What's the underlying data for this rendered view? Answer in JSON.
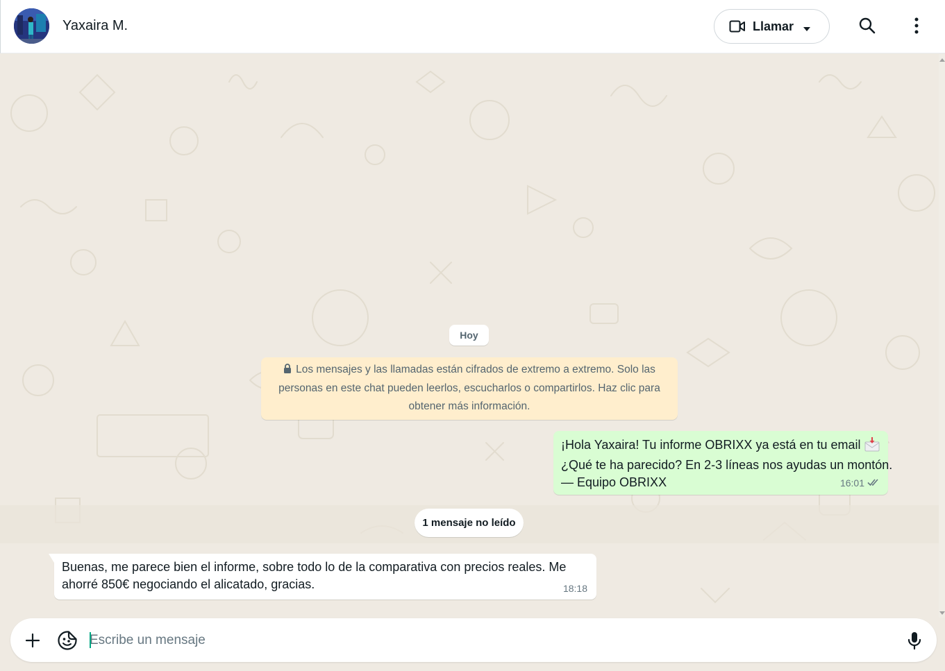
{
  "header": {
    "contact_name": "Yaxaira M.",
    "call_label": "Llamar"
  },
  "chat": {
    "date_chip": "Hoy",
    "encryption_notice": {
      "lines": [
        "Los mensajes y las llamadas están cifrados de extremo a extremo. Solo las",
        "personas en este chat pueden leerlos, escucharlos o compartirlos. Haz clic para",
        "obtener más información."
      ]
    },
    "outgoing_message": {
      "lines": [
        "¡Hola Yaxaira! Tu informe OBRIXX ya está en tu email",
        "¿Qué te ha parecido? En 2-3 líneas nos ayudas un montón.",
        "— Equipo OBRIXX"
      ],
      "time": "16:01",
      "status": "read"
    },
    "unread_divider": "1 mensaje no leído",
    "incoming_message": {
      "lines": [
        "Buenas, me parece bien el informe, sobre todo lo de la comparativa con precios reales. Me",
        "ahorré 850€ negociando el alicatado, gracias."
      ],
      "time": "18:18"
    }
  },
  "composer": {
    "placeholder": "Escribe un mensaje"
  },
  "colors": {
    "chat_background": "#efeae2",
    "outgoing_bubble": "#d9fdd3",
    "incoming_bubble": "#ffffff",
    "encryption_notice_bg": "#ffeecd",
    "read_ticks": "#667781"
  }
}
